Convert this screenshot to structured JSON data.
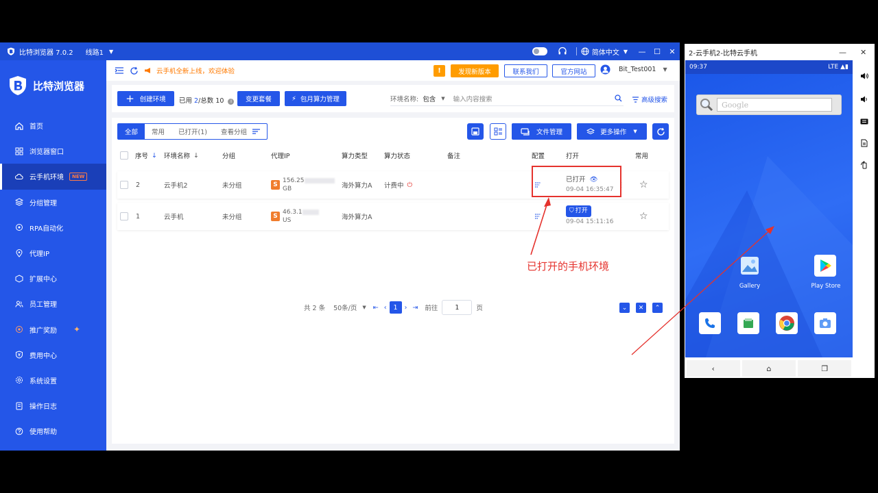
{
  "titlebar": {
    "app_title": "比特浏览器 7.0.2",
    "line": "线路1",
    "language": "简体中文",
    "icons": [
      "shield-logo-icon",
      "toggle-icon",
      "headset-icon",
      "globe-icon",
      "minimize-icon",
      "maximize-icon",
      "close-icon"
    ]
  },
  "sidebar": {
    "brand": "比特浏览器",
    "items": [
      {
        "label": "首页",
        "icon": "home-icon"
      },
      {
        "label": "浏览器窗口",
        "icon": "grid-icon"
      },
      {
        "label": "云手机环境",
        "icon": "cloud-icon",
        "badge": "NEW",
        "active": true
      },
      {
        "label": "分组管理",
        "icon": "layers-icon"
      },
      {
        "label": "RPA自动化",
        "icon": "rpa-icon"
      },
      {
        "label": "代理IP",
        "icon": "location-icon"
      },
      {
        "label": "扩展中心",
        "icon": "extension-icon"
      },
      {
        "label": "员工管理",
        "icon": "users-icon"
      },
      {
        "label": "推广奖励",
        "icon": "gift-icon"
      },
      {
        "label": "费用中心",
        "icon": "shield-yen-icon"
      },
      {
        "label": "系统设置",
        "icon": "gear-icon"
      },
      {
        "label": "操作日志",
        "icon": "log-icon"
      },
      {
        "label": "使用帮助",
        "icon": "help-icon"
      }
    ]
  },
  "topbar": {
    "announcement": "云手机全新上线，欢迎体验",
    "warn_label": "!",
    "new_version": "发现新版本",
    "contact": "联系我们",
    "website": "官方网站",
    "username": "Bit_Test001"
  },
  "toolbar": {
    "create": "创建环境",
    "usage_prefix": "已用 ",
    "usage_used": "2",
    "usage_suffix": "/总数 10",
    "change_plan": "变更套餐",
    "monthly": "包月算力管理",
    "filter_label": "环境名称:",
    "filter_mode": "包含",
    "search_placeholder": "输入内容搜索",
    "advanced": "高级搜索"
  },
  "tabs": [
    "全部",
    "常用",
    "已打开(1)",
    "查看分组"
  ],
  "actions": {
    "file_manage": "文件管理",
    "more_ops": "更多操作"
  },
  "table": {
    "headers": {
      "index": "序号",
      "name": "环境名称",
      "group": "分组",
      "proxy": "代理IP",
      "compute_type": "算力类型",
      "compute_status": "算力状态",
      "note": "备注",
      "config": "配置",
      "open": "打开",
      "common": "常用"
    },
    "rows": [
      {
        "index": "2",
        "name": "云手机2",
        "group": "未分组",
        "ip": "156.25",
        "region": "GB",
        "compute_type": "海外算力A",
        "compute_status": "计费中",
        "open_state": "已打开",
        "time": "09-04 16:35:47"
      },
      {
        "index": "1",
        "name": "云手机",
        "group": "未分组",
        "ip": "46.3.1",
        "region": "US",
        "compute_type": "海外算力A",
        "compute_status": "",
        "open_state": "打开",
        "time": "09-04 15:11:16"
      }
    ]
  },
  "pagination": {
    "total": "共 2 条",
    "per_page": "50条/页",
    "current": "1",
    "goto_label": "前往",
    "goto_value": "1",
    "page_suffix": "页"
  },
  "annotation": "已打开的手机环境",
  "phone": {
    "window_title": "2-云手机2-比特云手机",
    "time": "09:37",
    "signal": "LTE",
    "search_hint": "Google",
    "apps": [
      {
        "label": "Gallery",
        "icon": "gallery-icon"
      },
      {
        "label": "Play Store",
        "icon": "play-store-icon"
      }
    ],
    "dock": [
      "phone-icon",
      "files-icon",
      "chrome-icon",
      "camera-icon"
    ],
    "navbar": [
      "back-icon",
      "home-icon",
      "recents-icon"
    ],
    "side_controls": [
      "volume-up-icon",
      "volume-down-icon",
      "keyboard-icon",
      "file-icon",
      "rotate-icon"
    ]
  },
  "colors": {
    "brand": "#2456e8",
    "accent": "#ff9c00",
    "annotation": "#e5322d"
  }
}
